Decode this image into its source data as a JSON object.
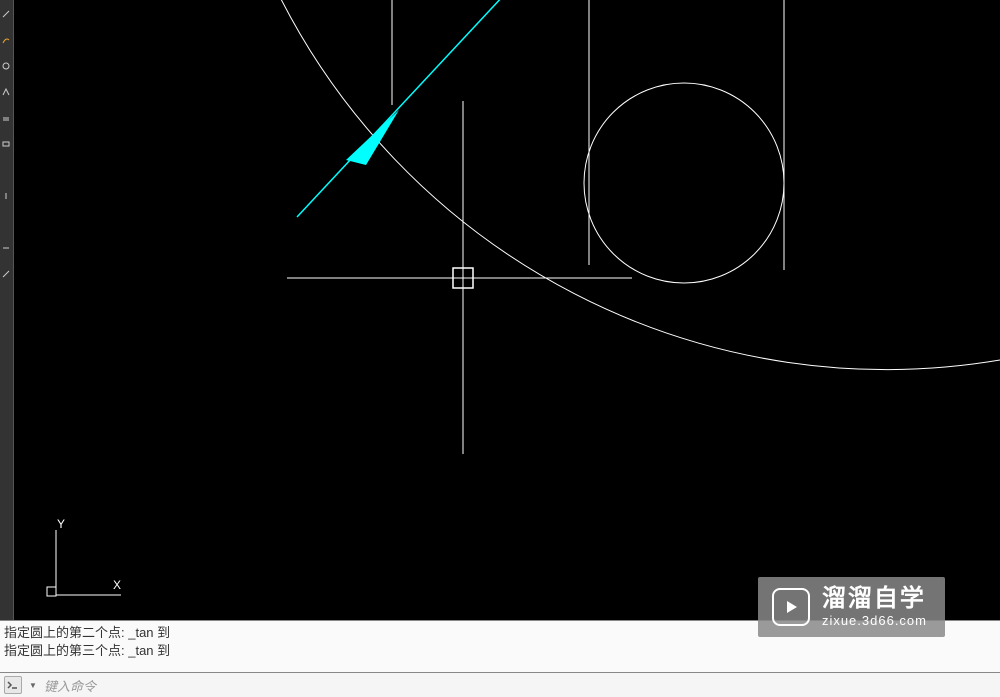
{
  "toolbar": {
    "tools": [
      "line",
      "circle",
      "arc",
      "polyline",
      "rect",
      "text",
      "dim",
      "hatch",
      "offset"
    ]
  },
  "canvas": {
    "ucs": {
      "x_label": "X",
      "y_label": "Y"
    }
  },
  "command_history": {
    "line1": "指定圆上的第二个点:  _tan  到",
    "line2": "指定圆上的第三个点:  _tan  到"
  },
  "command_input": {
    "placeholder": "键入命令"
  },
  "watermark": {
    "title": "溜溜自学",
    "url": "zixue.3d66.com"
  }
}
